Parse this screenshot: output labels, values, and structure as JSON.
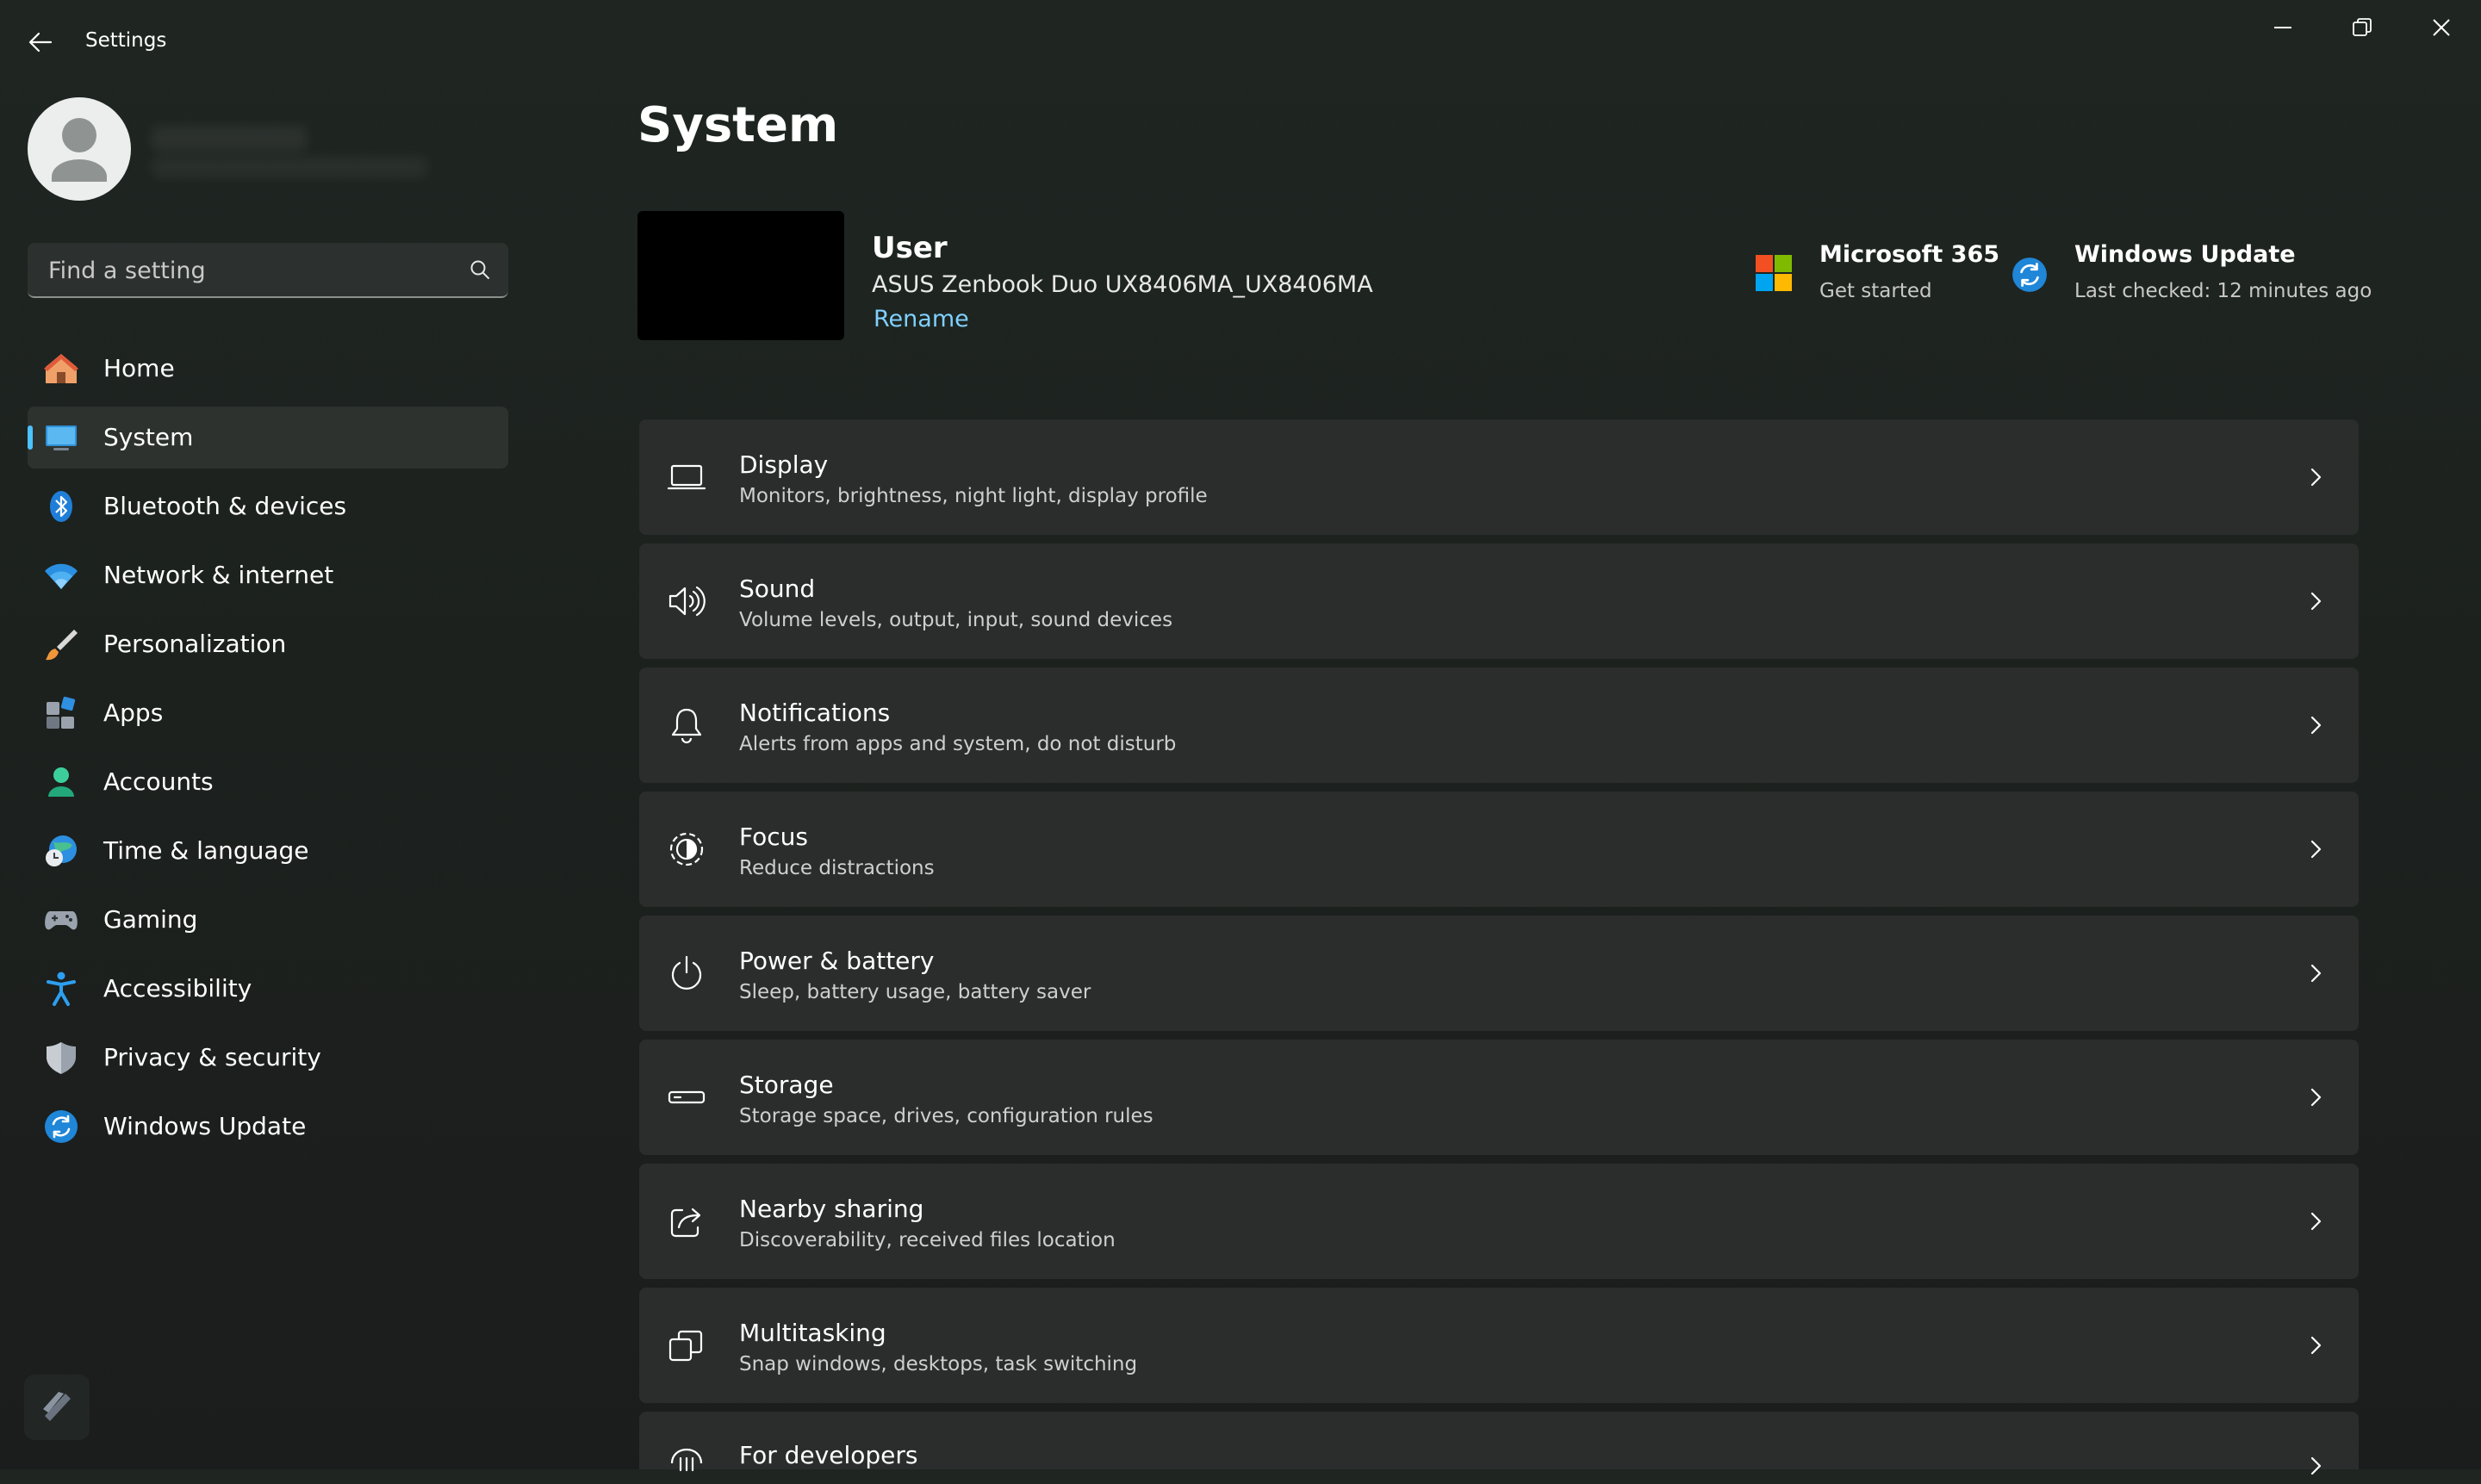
{
  "window": {
    "title": "Settings",
    "controls": [
      "minimize-icon",
      "restore-icon",
      "close-icon"
    ]
  },
  "search": {
    "placeholder": "Find a setting"
  },
  "sidebar": {
    "items": [
      {
        "label": "Home",
        "icon": "home-icon"
      },
      {
        "label": "System",
        "icon": "system-icon",
        "selected": true
      },
      {
        "label": "Bluetooth & devices",
        "icon": "bluetooth-icon"
      },
      {
        "label": "Network & internet",
        "icon": "wifi-icon"
      },
      {
        "label": "Personalization",
        "icon": "brush-icon"
      },
      {
        "label": "Apps",
        "icon": "apps-icon"
      },
      {
        "label": "Accounts",
        "icon": "accounts-icon"
      },
      {
        "label": "Time & language",
        "icon": "globe-clock-icon"
      },
      {
        "label": "Gaming",
        "icon": "gamepad-icon"
      },
      {
        "label": "Accessibility",
        "icon": "accessibility-icon"
      },
      {
        "label": "Privacy & security",
        "icon": "shield-icon"
      },
      {
        "label": "Windows Update",
        "icon": "windows-update-icon"
      }
    ]
  },
  "main": {
    "title": "System",
    "device": {
      "name": "User",
      "model": "ASUS Zenbook Duo UX8406MA_UX8406MA",
      "rename_label": "Rename"
    },
    "quick_links": [
      {
        "title": "Microsoft 365",
        "subtitle": "Get started",
        "icon": "microsoft-logo-icon"
      },
      {
        "title": "Windows Update",
        "subtitle": "Last checked: 12 minutes ago",
        "icon": "windows-update-icon"
      }
    ],
    "cards": [
      {
        "title": "Display",
        "subtitle": "Monitors, brightness, night light, display profile",
        "icon": "display-icon"
      },
      {
        "title": "Sound",
        "subtitle": "Volume levels, output, input, sound devices",
        "icon": "speaker-icon"
      },
      {
        "title": "Notifications",
        "subtitle": "Alerts from apps and system, do not disturb",
        "icon": "bell-icon"
      },
      {
        "title": "Focus",
        "subtitle": "Reduce distractions",
        "icon": "focus-icon"
      },
      {
        "title": "Power & battery",
        "subtitle": "Sleep, battery usage, battery saver",
        "icon": "power-icon"
      },
      {
        "title": "Storage",
        "subtitle": "Storage space, drives, configuration rules",
        "icon": "storage-icon"
      },
      {
        "title": "Nearby sharing",
        "subtitle": "Discoverability, received files location",
        "icon": "share-icon"
      },
      {
        "title": "Multitasking",
        "subtitle": "Snap windows, desktops, task switching",
        "icon": "multitasking-icon"
      },
      {
        "title": "For developers",
        "subtitle": "",
        "icon": "developer-icon"
      }
    ]
  },
  "colors": {
    "accent": "#4cc2ff",
    "link": "#7fd1ff",
    "card": "#2a2d2c",
    "selected": "#2d322f"
  }
}
